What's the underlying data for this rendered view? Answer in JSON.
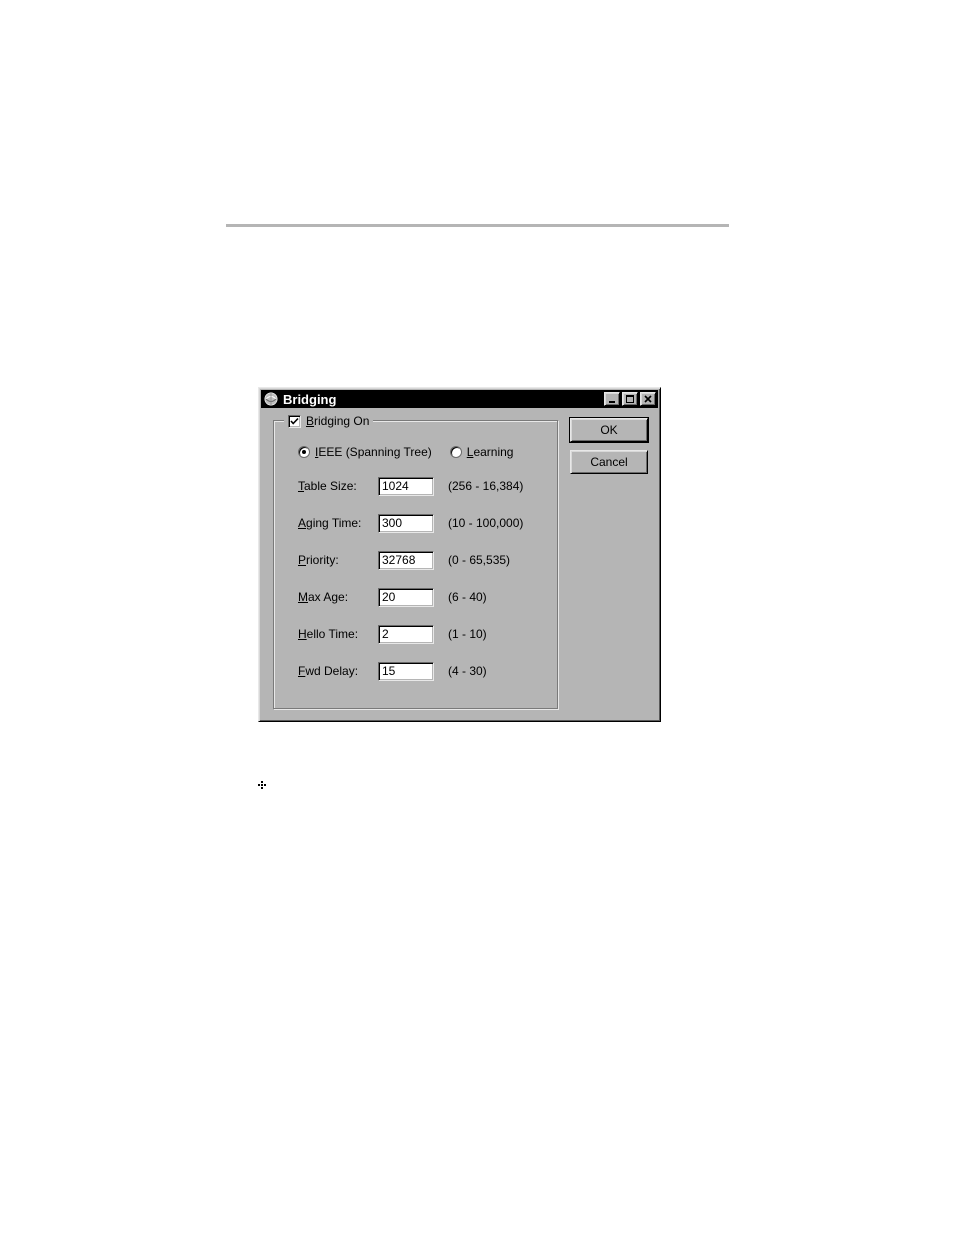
{
  "dialog": {
    "title": "Bridging",
    "group_label_prefix": "B",
    "group_label_rest": "ridging On",
    "bridging_on_checked": true,
    "radios": {
      "ieee": {
        "prefix": "I",
        "rest": "EEE (Spanning Tree)",
        "selected": true
      },
      "learning": {
        "prefix": "L",
        "rest": "earning",
        "selected": false
      }
    },
    "fields": {
      "table_size": {
        "prefix": "T",
        "rest": "able Size:",
        "value": "1024",
        "hint": "(256 - 16,384)"
      },
      "aging_time": {
        "prefix": "A",
        "rest": "ging Time:",
        "value": "300",
        "hint": "(10 - 100,000)"
      },
      "priority": {
        "prefix": "P",
        "rest": "riority:",
        "value": "32768",
        "hint": "(0 - 65,535)"
      },
      "max_age": {
        "prefix": "M",
        "rest": "ax Age:",
        "value": "20",
        "hint": "(6 - 40)"
      },
      "hello_time": {
        "prefix": "H",
        "rest": "ello Time:",
        "value": "2",
        "hint": "(1 - 10)"
      },
      "fwd_delay": {
        "prefix": "F",
        "rest": "wd Delay:",
        "value": "15",
        "hint": "(4 - 30)"
      }
    },
    "buttons": {
      "ok": "OK",
      "cancel": "Cancel"
    }
  }
}
